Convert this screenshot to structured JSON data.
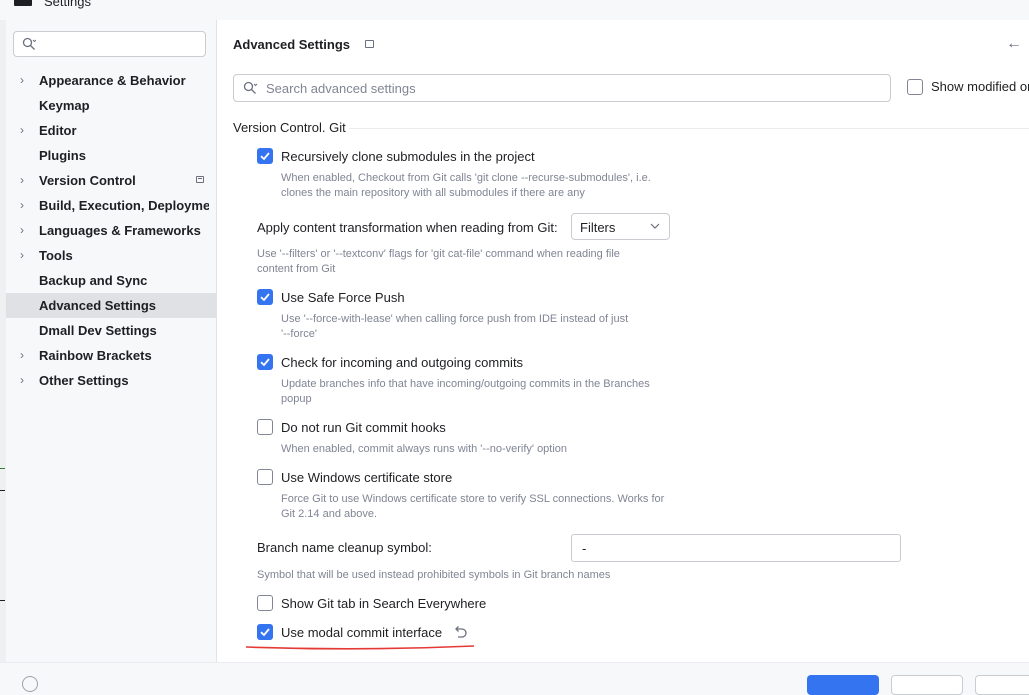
{
  "window": {
    "title": "Settings"
  },
  "sidebar": {
    "search_placeholder": "",
    "items": [
      {
        "label": "Appearance & Behavior",
        "expandable": true
      },
      {
        "label": "Keymap",
        "expandable": false
      },
      {
        "label": "Editor",
        "expandable": true
      },
      {
        "label": "Plugins",
        "expandable": false
      },
      {
        "label": "Version Control",
        "expandable": true
      },
      {
        "label": "Build, Execution, Deployment",
        "expandable": true
      },
      {
        "label": "Languages & Frameworks",
        "expandable": true
      },
      {
        "label": "Tools",
        "expandable": true
      },
      {
        "label": "Backup and Sync",
        "expandable": false
      },
      {
        "label": "Advanced Settings",
        "expandable": false,
        "selected": true
      },
      {
        "label": "Dmall Dev Settings",
        "expandable": false
      },
      {
        "label": "Rainbow Brackets",
        "expandable": true
      },
      {
        "label": "Other Settings",
        "expandable": true
      }
    ]
  },
  "main": {
    "title": "Advanced Settings",
    "search_placeholder": "Search advanced settings",
    "show_modified_label": "Show modified only",
    "show_modified_checked": false,
    "section_title": "Version Control. Git",
    "options": {
      "recursive_clone": {
        "label": "Recursively clone submodules in the project",
        "checked": true,
        "desc_line1": "When enabled, Checkout from Git calls 'git clone --recurse-submodules', i.e.",
        "desc_line2": "clones the main repository with all submodules if there are any"
      },
      "content_transform": {
        "label": "Apply content transformation when reading from Git:",
        "value": "Filters",
        "desc_line1": "Use '--filters' or '--textconv' flags for 'git cat-file' command when reading file",
        "desc_line2": "content from Git"
      },
      "safe_force_push": {
        "label": "Use Safe Force Push",
        "checked": true,
        "desc_line1": "Use '--force-with-lease' when calling force push from IDE instead of just",
        "desc_line2": "'--force'"
      },
      "check_commits": {
        "label": "Check for incoming and outgoing commits",
        "checked": true,
        "desc_line1": "Update branches info that have incoming/outgoing commits in the Branches",
        "desc_line2": "popup"
      },
      "no_hooks": {
        "label": "Do not run Git commit hooks",
        "checked": false,
        "desc_line1": "When enabled, commit always runs with '--no-verify' option"
      },
      "win_cert": {
        "label": "Use Windows certificate store",
        "checked": false,
        "desc_line1": "Force Git to use Windows certificate store to verify SSL connections. Works for",
        "desc_line2": "Git 2.14 and above."
      },
      "branch_cleanup": {
        "label": "Branch name cleanup symbol:",
        "value": "-",
        "desc_line1": "Symbol that will be used instead prohibited symbols in Git branch names"
      },
      "git_tab": {
        "label": "Show Git tab in Search Everywhere",
        "checked": false
      },
      "modal_commit": {
        "label": "Use modal commit interface",
        "checked": true
      }
    }
  },
  "colors": {
    "accent": "#3574f0",
    "highlight_underline": "#e53935",
    "selected_bg": "#dfe1e5"
  }
}
